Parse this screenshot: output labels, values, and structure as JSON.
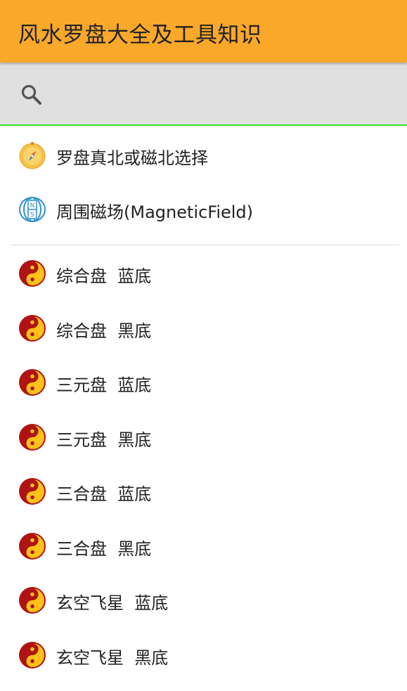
{
  "app": {
    "title": "风水罗盘大全及工具知识",
    "accent_color": "#F9A82A"
  },
  "search": {
    "icon": "search-icon",
    "placeholder": ""
  },
  "tools": [
    {
      "label": "罗盘真北或磁北选择",
      "icon": "compass-icon"
    },
    {
      "label": "周围磁场(MagneticField)",
      "icon": "magnet-icon"
    }
  ],
  "compasses": [
    {
      "label": "综合盘  蓝底",
      "icon": "yin-yang-icon"
    },
    {
      "label": "综合盘  黑底",
      "icon": "yin-yang-icon"
    },
    {
      "label": "三元盘  蓝底",
      "icon": "yin-yang-icon"
    },
    {
      "label": "三元盘  黑底",
      "icon": "yin-yang-icon"
    },
    {
      "label": "三合盘  蓝底",
      "icon": "yin-yang-icon"
    },
    {
      "label": "三合盘  黑底",
      "icon": "yin-yang-icon"
    },
    {
      "label": "玄空飞星  蓝底",
      "icon": "yin-yang-icon"
    },
    {
      "label": "玄空飞星  黑底",
      "icon": "yin-yang-icon"
    }
  ]
}
